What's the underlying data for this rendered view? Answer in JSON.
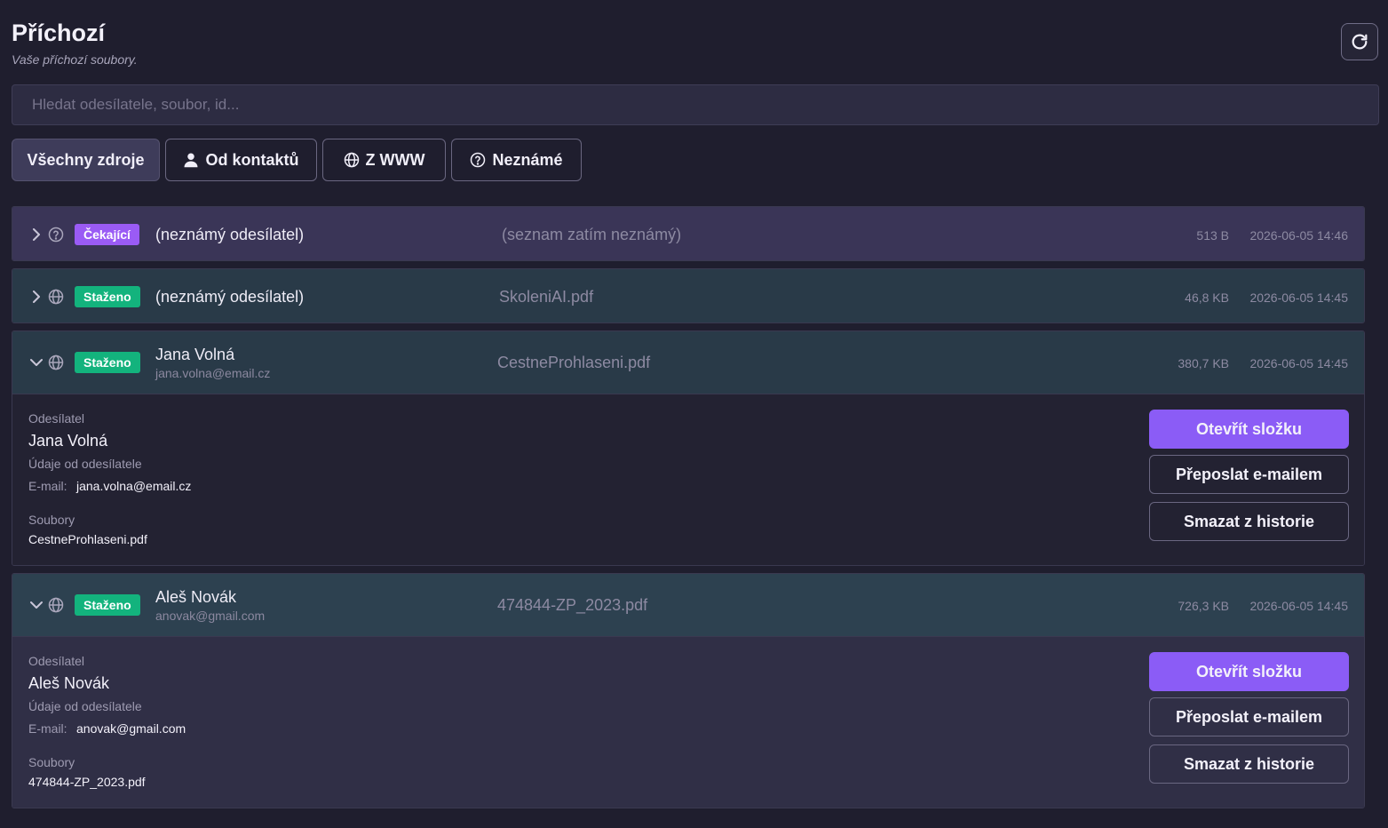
{
  "header": {
    "title": "Příchozí",
    "subtitle": "Vaše příchozí soubory."
  },
  "search": {
    "placeholder": "Hledat odesílatele, soubor, id...",
    "value": ""
  },
  "filters": [
    {
      "label": "Všechny zdroje",
      "icon": "",
      "active": true
    },
    {
      "label": "Od kontaktů",
      "icon": "person-icon",
      "active": false
    },
    {
      "label": "Z WWW",
      "icon": "globe-icon",
      "active": false
    },
    {
      "label": "Neznámé",
      "icon": "question-circle-icon",
      "active": false
    }
  ],
  "colors": {
    "pending": "#9a5bf5",
    "done": "#13b37d",
    "accent": "#8b5cf6"
  },
  "items": [
    {
      "expanded": false,
      "source_icon": "question-circle-icon",
      "status": "Čekající",
      "sender": "(neznámý odesílatel)",
      "email": "",
      "file": "(seznam zatím neznámý)",
      "size": "513 B",
      "date": "2026-06-05 14:46"
    },
    {
      "expanded": false,
      "source_icon": "globe-icon",
      "status": "Staženo",
      "sender": "(neznámý odesílatel)",
      "email": "",
      "file": "SkoleniAI.pdf",
      "size": "46,8 KB",
      "date": "2026-06-05 14:45"
    },
    {
      "expanded": true,
      "source_icon": "globe-icon",
      "status": "Staženo",
      "sender": "Jana Volná",
      "email": "jana.volna@email.cz",
      "file": "CestneProhlaseni.pdf",
      "size": "380,7 KB",
      "date": "2026-06-05 14:45",
      "detail": {
        "sender_label": "Odesílatel",
        "sender_name": "Jana Volná",
        "info_label": "Údaje od odesílatele",
        "email_label": "E-mail:",
        "email": "jana.volna@email.cz",
        "files_label": "Soubory",
        "files": "CestneProhlaseni.pdf"
      }
    },
    {
      "expanded": true,
      "source_icon": "globe-icon",
      "status": "Staženo",
      "sender": "Aleš Novák",
      "email": "anovak@gmail.com",
      "file": "474844-ZP_2023.pdf",
      "size": "726,3 KB",
      "date": "2026-06-05 14:45",
      "detail": {
        "sender_label": "Odesílatel",
        "sender_name": "Aleš Novák",
        "info_label": "Údaje od odesílatele",
        "email_label": "E-mail:",
        "email": "anovak@gmail.com",
        "files_label": "Soubory",
        "files": "474844-ZP_2023.pdf"
      }
    }
  ],
  "actions": {
    "open_folder": "Otevřít složku",
    "forward_email": "Přeposlat e-mailem",
    "delete_history": "Smazat z historie"
  }
}
